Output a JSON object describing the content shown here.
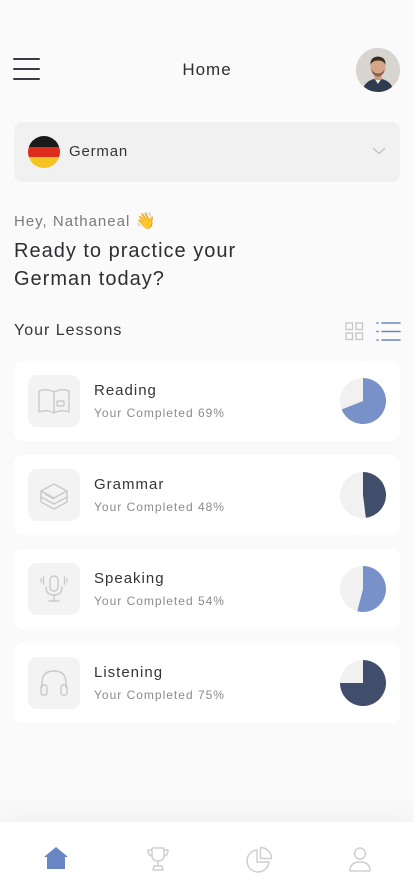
{
  "header": {
    "title": "Home",
    "menu_icon": "hamburger-menu-icon",
    "avatar": "user-avatar"
  },
  "language": {
    "selected": "German",
    "flag_colors": [
      "#1a1a1a",
      "#dd2b1c",
      "#f7c320"
    ],
    "icon": "chevron-down-icon"
  },
  "greeting": {
    "text": "Hey, Nathaneal",
    "emoji": "👋",
    "headline": "Ready to practice your German today?"
  },
  "lessons": {
    "title": "Your Lessons",
    "view_modes": [
      "grid-view-icon",
      "list-view-icon"
    ],
    "active_view": "list",
    "items": [
      {
        "name": "Reading",
        "progress_text": "Your Completed 69%",
        "percent": 69,
        "color": "#7891c9",
        "icon": "book-icon"
      },
      {
        "name": "Grammar",
        "progress_text": "Your Completed 48%",
        "percent": 48,
        "color": "#404e6b",
        "icon": "books-stack-icon"
      },
      {
        "name": "Speaking",
        "progress_text": "Your Completed 54%",
        "percent": 54,
        "color": "#7891c9",
        "icon": "microphone-icon"
      },
      {
        "name": "Listening",
        "progress_text": "Your Completed 75%",
        "percent": 75,
        "color": "#404e6b",
        "icon": "headphones-icon"
      }
    ]
  },
  "bottom_nav": {
    "active": "home",
    "items": [
      "home-icon",
      "trophy-icon",
      "pie-chart-icon",
      "profile-icon"
    ]
  },
  "colors": {
    "accent": "#6b86c4",
    "muted_icon": "#c9c9cd",
    "pie_track": "#f1f1f2"
  }
}
